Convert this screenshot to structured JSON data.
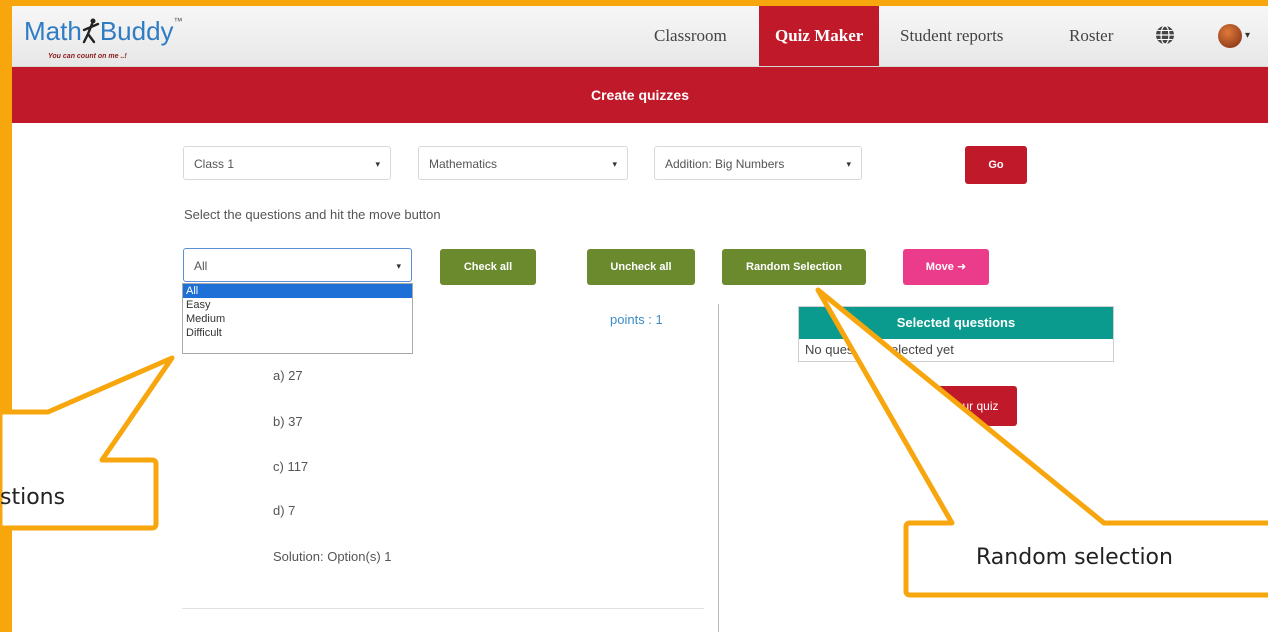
{
  "logo": {
    "name": "MathBuddy",
    "name_left": "Math",
    "name_right": "Buddy",
    "trademark": "™",
    "tagline": "You can count on me ..!"
  },
  "nav": {
    "items": [
      "Classroom",
      "Quiz Maker",
      "Student reports",
      "Roster"
    ],
    "active": "Quiz Maker",
    "globe_icon": "globe-icon",
    "avatar_icon": "avatar-icon"
  },
  "banner": {
    "title": "Create quizzes"
  },
  "filters": {
    "class": "Class 1",
    "subject": "Mathematics",
    "topic": "Addition: Big Numbers",
    "go_label": "Go"
  },
  "instruction": "Select the questions and hit the move button",
  "difficulty": {
    "value": "All",
    "options": [
      "All",
      "Easy",
      "Medium",
      "Difficult"
    ],
    "selected_option": "All"
  },
  "actions": {
    "check_all": "Check all",
    "uncheck_all": "Uncheck all",
    "random_selection": "Random Selection",
    "move": "Move ➜"
  },
  "question": {
    "points": "points : 1",
    "options": [
      "a) 27",
      "b) 37",
      "c) 117",
      "d) 7"
    ],
    "solution": "Solution: Option(s) 1"
  },
  "selected_panel": {
    "title": "Selected questions",
    "empty_text": "No questions selected yet",
    "create_label": "Create your quiz"
  },
  "callouts": {
    "left": "stions",
    "right": "Random selection"
  },
  "colors": {
    "brand_red": "#c0192a",
    "green": "#6a8a2d",
    "pink": "#ea3c8a",
    "teal": "#0a9b8e",
    "callout_orange": "#f7a60d"
  }
}
